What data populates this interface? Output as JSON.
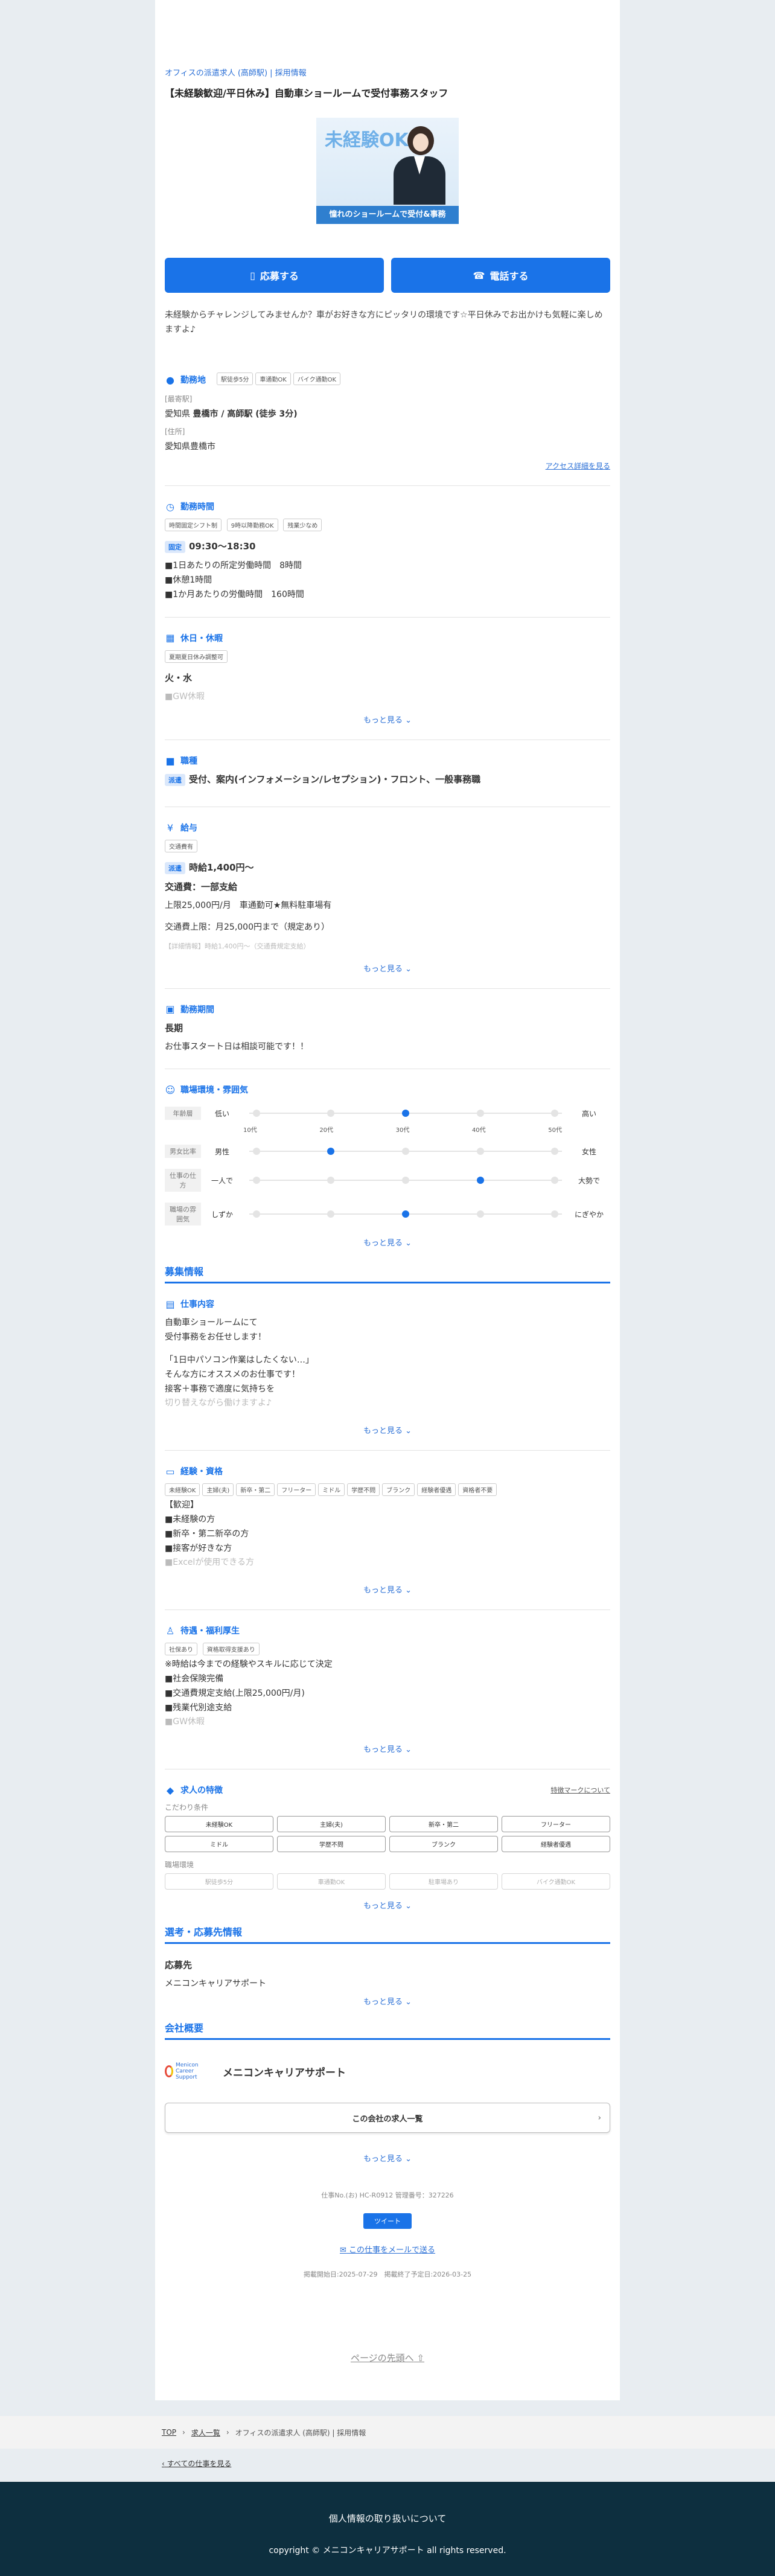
{
  "header": {
    "crumb": "オフィスの派遣求人 (高師駅) | 採用情報",
    "title": "【未経験歓迎/平日休み】自動車ショールームで受付事務スタッフ"
  },
  "hero": {
    "big_text": "未経験OK!",
    "banner": "憧れのショールームで受付&事務"
  },
  "actions": {
    "apply": "応募する",
    "phone": "電話する"
  },
  "lead": "未経験からチャレンジしてみませんか？車がお好きな方にピッタリの環境です☆平日休みでお出かけも気軽に楽しめますよ♪",
  "location": {
    "title": "勤務地",
    "tags": [
      "駅徒歩5分",
      "車通勤OK",
      "バイク通勤OK"
    ],
    "nearest_label": "[最寄駅]",
    "nearest_prefix": "愛知県",
    "nearest": "豊橋市 / 高師駅 (徒歩 3分)",
    "address_label": "[住所]",
    "address": "愛知県豊橋市",
    "access_link": "アクセス詳細を見る"
  },
  "hours": {
    "title": "勤務時間",
    "tags": [
      "時間固定シフト制",
      "9時以降勤務OK",
      "残業少なめ"
    ],
    "pill": "固定",
    "time": "09:30〜18:30",
    "lines": [
      "■1日あたりの所定労働時間　8時間",
      "■休憩1時間",
      "■1か月あたりの労働時間　160時間"
    ]
  },
  "holiday": {
    "title": "休日・休暇",
    "tags": [
      "夏期夏日休み調整可"
    ],
    "days": "火・水",
    "fade": "■GW休暇",
    "more": "もっと見る"
  },
  "jobtype": {
    "title": "職種",
    "pill": "派遣",
    "text": "受付、案内(インフォメーション/レセプション)・フロント、一般事務職"
  },
  "salary": {
    "title": "給与",
    "tags": [
      "交通費有"
    ],
    "pill": "派遣",
    "wage": "時給1,400円〜",
    "transport": "交通費：一部支給",
    "line1": "上限25,000円/月　車通勤可★無料駐車場有",
    "line2": "交通費上限：月25,000円まで（規定あり）",
    "fade": "【詳細情報】時給1,400円〜（交通費規定支給）",
    "more": "もっと見る"
  },
  "period": {
    "title": "勤務期間",
    "value": "長期",
    "text": "お仕事スタート日は相談可能です！！"
  },
  "environment": {
    "title": "職場環境・雰囲気",
    "rows": [
      {
        "label": "年齢層",
        "left": "低い",
        "right": "高い",
        "active": 2
      },
      {
        "label": "男女比率",
        "left": "男性",
        "right": "女性",
        "active": 1
      },
      {
        "label": "仕事の仕方",
        "left": "一人で",
        "right": "大勢で",
        "active": 3
      },
      {
        "label": "職場の雰囲気",
        "left": "しずか",
        "right": "にぎやか",
        "active": 2
      }
    ],
    "ticks": [
      "10代",
      "20代",
      "30代",
      "40代",
      "50代"
    ],
    "more": "もっと見る"
  },
  "recruit": {
    "category": "募集情報",
    "content_title": "仕事内容",
    "content": [
      "自動車ショールームにて",
      "受付事務をお任せします！",
      "",
      "「1日中パソコン作業はしたくない…」",
      "そんな方にオススメのお仕事です！",
      "接客＋事務で適度に気持ちを"
    ],
    "content_fade": "切り替えながら働けますよ♪",
    "content_more": "もっと見る",
    "exp_title": "経験・資格",
    "exp_tags": [
      "未経験OK",
      "主婦(夫)",
      "新卒・第二",
      "フリーター",
      "ミドル",
      "学歴不問",
      "ブランク",
      "経験者優遇",
      "資格者不要"
    ],
    "exp_lines": [
      "【歓迎】",
      "■未経験の方",
      "■新卒・第二新卒の方",
      "■接客が好きな方"
    ],
    "exp_fade": "■Excelが使用できる方",
    "exp_more": "もっと見る",
    "welfare_title": "待遇・福利厚生",
    "welfare_tags": [
      "社保あり",
      "資格取得支援あり"
    ],
    "welfare_lines": [
      "※時給は今までの経験やスキルに応じて決定",
      "■社会保険完備",
      "■交通費規定支給(上限25,000円/月)",
      "■残業代別途支給"
    ],
    "welfare_fade": "■GW休暇",
    "welfare_more": "もっと見る",
    "feat_title": "求人の特徴",
    "feat_link": "特徴マークについて",
    "feat_group1": "こだわり条件",
    "feat_items1": [
      "未経験OK",
      "主婦(夫)",
      "新卒・第二",
      "フリーター",
      "ミドル",
      "学歴不問",
      "ブランク",
      "経験者優遇"
    ],
    "feat_group2": "職場環境",
    "feat_items2": [
      "駅徒歩5分",
      "車通勤OK",
      "駐車場あり",
      "バイク通勤OK"
    ],
    "feat_more": "もっと見る"
  },
  "apply_info": {
    "category": "選考・応募先情報",
    "title": "応募先",
    "company": "メニコンキャリアサポート",
    "more": "もっと見る"
  },
  "company": {
    "category": "会社概要",
    "logo_text": "Menicon Career Support",
    "name": "メニコンキャリアサポート",
    "jobs_btn": "この会社の求人一覧",
    "more": "もっと見る"
  },
  "meta": {
    "ids": "仕事No.(お) HC-R0912 管理番号：327226",
    "tweet": "ツイート",
    "mail": "この仕事をメールで送る",
    "dates": "掲載開始日:2025-07-29　掲載終了予定日:2026-03-25",
    "pagetop": "ページの先頭へ"
  },
  "breadcrumb": {
    "top": "TOP",
    "list": "求人一覧",
    "current": "オフィスの派遣求人 (高師駅) | 採用情報"
  },
  "back": "すべての仕事を見る",
  "footer": {
    "privacy": "個人情報の取り扱いについて",
    "copyright": "copyright © メニコンキャリアサポート all rights reserved."
  },
  "colors": {
    "accent": "#1a73e8",
    "footer": "#0d2f3f"
  }
}
